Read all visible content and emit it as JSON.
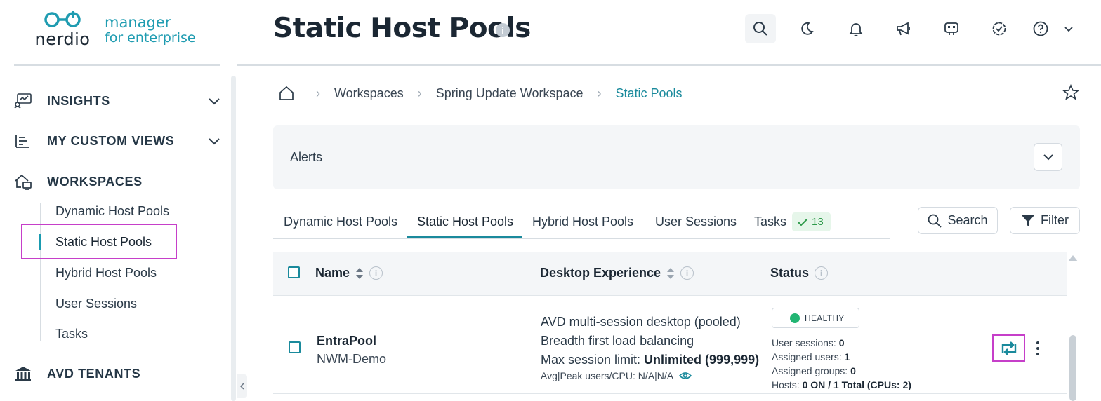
{
  "logo": {
    "brand": "nerdio",
    "line1": "manager",
    "line2": "for enterprise"
  },
  "sidebar": {
    "sections": [
      {
        "label": "INSIGHTS",
        "icon": "insights-icon",
        "expandable": true
      },
      {
        "label": "MY CUSTOM VIEWS",
        "icon": "custom-views-icon",
        "expandable": true
      },
      {
        "label": "WORKSPACES",
        "icon": "workspaces-icon",
        "expandable": false
      },
      {
        "label": "AVD TENANTS",
        "icon": "bank-icon",
        "expandable": false
      }
    ],
    "workspace_items": [
      {
        "label": "Dynamic Host Pools"
      },
      {
        "label": "Static Host Pools",
        "active": true
      },
      {
        "label": "Hybrid Host Pools"
      },
      {
        "label": "User Sessions"
      },
      {
        "label": "Tasks"
      }
    ]
  },
  "header": {
    "title": "Static Host Pools",
    "icons": [
      "search-icon",
      "moon-icon",
      "bell-icon",
      "megaphone-icon",
      "bot-icon",
      "badge-check-icon",
      "help-icon"
    ]
  },
  "breadcrumb": {
    "items": [
      "Workspaces",
      "Spring Update Workspace",
      "Static Pools"
    ]
  },
  "alerts": {
    "label": "Alerts"
  },
  "tabs": {
    "items": [
      "Dynamic Host Pools",
      "Static Host Pools",
      "Hybrid Host Pools",
      "User Sessions",
      "Tasks"
    ],
    "active_index": 1,
    "tasks_badge": "13"
  },
  "toolbar": {
    "search_label": "Search",
    "filter_label": "Filter"
  },
  "table": {
    "columns": {
      "name": "Name",
      "desktop": "Desktop Experience",
      "status": "Status"
    },
    "rows": [
      {
        "name": "EntraPool",
        "subtitle": "NWM-Demo",
        "desktop_type": "AVD multi-session desktop (pooled)",
        "load_balancing": "Breadth first load balancing",
        "max_session_label": "Max session limit:",
        "max_session_value": "Unlimited (999,999)",
        "avg_peak": "Avg|Peak users/CPU: N/A|N/A",
        "status": "HEALTHY",
        "user_sessions_label": "User sessions:",
        "user_sessions": "0",
        "assigned_users_label": "Assigned users:",
        "assigned_users": "1",
        "assigned_groups_label": "Assigned groups:",
        "assigned_groups": "0",
        "hosts_label": "Hosts:",
        "hosts": "0 ON / 1 Total (CPUs: 2)"
      }
    ]
  },
  "colors": {
    "accent": "#1a8a9c",
    "highlight": "#c63fc9",
    "healthy": "#22b573"
  }
}
